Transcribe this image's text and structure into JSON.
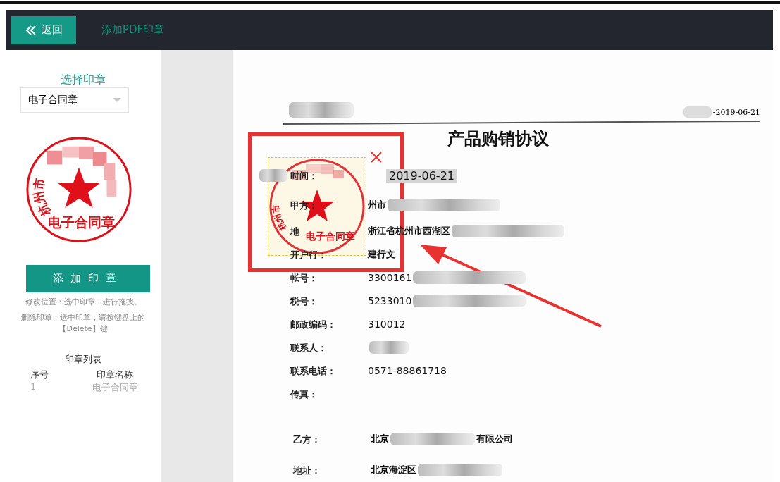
{
  "header": {
    "back_button": "返回",
    "title": "添加PDF印章"
  },
  "sidebar": {
    "select_label": "选择印章",
    "select_value": "电子合同章",
    "stamp_preview": {
      "city": "杭州市",
      "name": "电子合同章"
    },
    "add_button": "添加印章",
    "hints": [
      "修改位置：选中印章，进行拖拽。",
      "删除印章：选中印章，请按键盘上的【Delete】键"
    ],
    "stamp_list": {
      "title": "印章列表",
      "columns": [
        "序号",
        "印章名称"
      ],
      "rows": [
        {
          "index": "1",
          "name": "电子合同章"
        }
      ]
    }
  },
  "document": {
    "header_date": "-2019-06-21",
    "title": "产品购销协议",
    "party_a": [
      {
        "label": "时间：",
        "value": "2019-06-21",
        "blur": true,
        "kind": "date"
      },
      {
        "label": "甲方：",
        "value": "州市",
        "blur": true,
        "kind": "text"
      },
      {
        "label": "地",
        "value": "浙江省杭州市西湖区",
        "blur": true,
        "kind": "text"
      },
      {
        "label": "开户行：",
        "value": "建行文",
        "blur": false,
        "kind": "text"
      },
      {
        "label": "帐号：",
        "value": "3300161",
        "blur": true,
        "kind": "number"
      },
      {
        "label": "税号：",
        "value": "5233010",
        "blur": true,
        "kind": "number"
      },
      {
        "label": "邮政编码：",
        "value": "310012",
        "blur": false,
        "kind": "number"
      },
      {
        "label": "联系人：",
        "blur": true,
        "kind": "text"
      },
      {
        "label": "联系电话：",
        "value": "0571-88861718",
        "blur": false,
        "kind": "number"
      },
      {
        "label": "传真：",
        "blur": false,
        "kind": "text"
      }
    ],
    "party_b": [
      {
        "label": "乙方：",
        "value": "北京",
        "suffix": "有限公司",
        "blur": true
      },
      {
        "label": "地址：",
        "value": "北京海淀区",
        "blur": true
      }
    ],
    "placed_stamp": {
      "city": "杭州市",
      "name": "电子合同章",
      "selected": true
    }
  }
}
